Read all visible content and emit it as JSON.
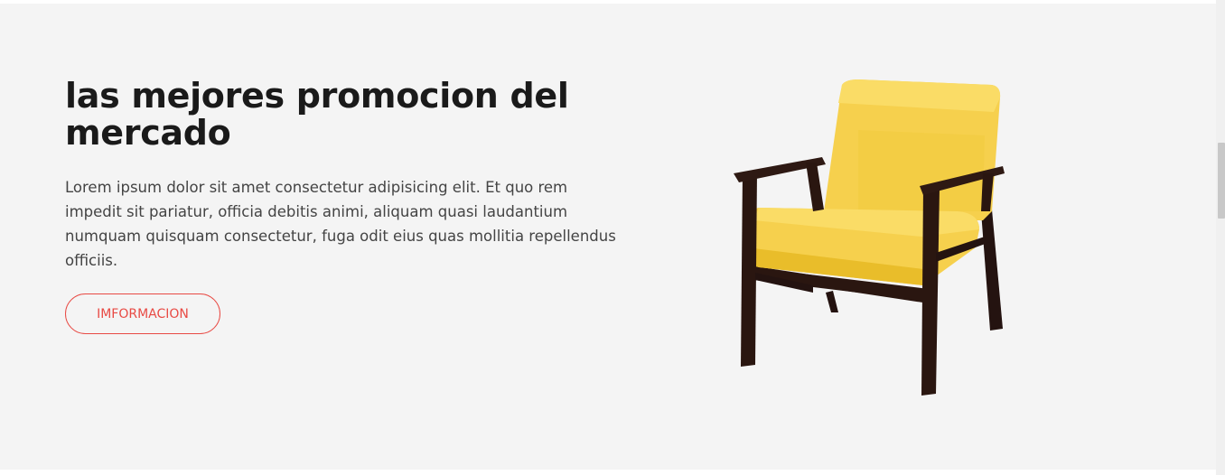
{
  "promo": {
    "title": "las mejores promocion del mercado",
    "description": "Lorem ipsum dolor sit amet consectetur adipisicing elit. Et quo rem impedit sit pariatur, officia debitis animi, aliquam quasi laudantium numquam quisquam consectetur, fuga odit eius quas mollitia repellendus officiis.",
    "button_label": "IMFORMACION"
  },
  "image": {
    "subject": "yellow upholstered armchair with dark wooden frame"
  },
  "colors": {
    "section_background": "#f4f4f4",
    "title": "#1a1a1a",
    "body_text": "#444444",
    "accent": "#e84a44",
    "chair_cushion": "#f6d04d",
    "chair_wood": "#2a1610"
  }
}
